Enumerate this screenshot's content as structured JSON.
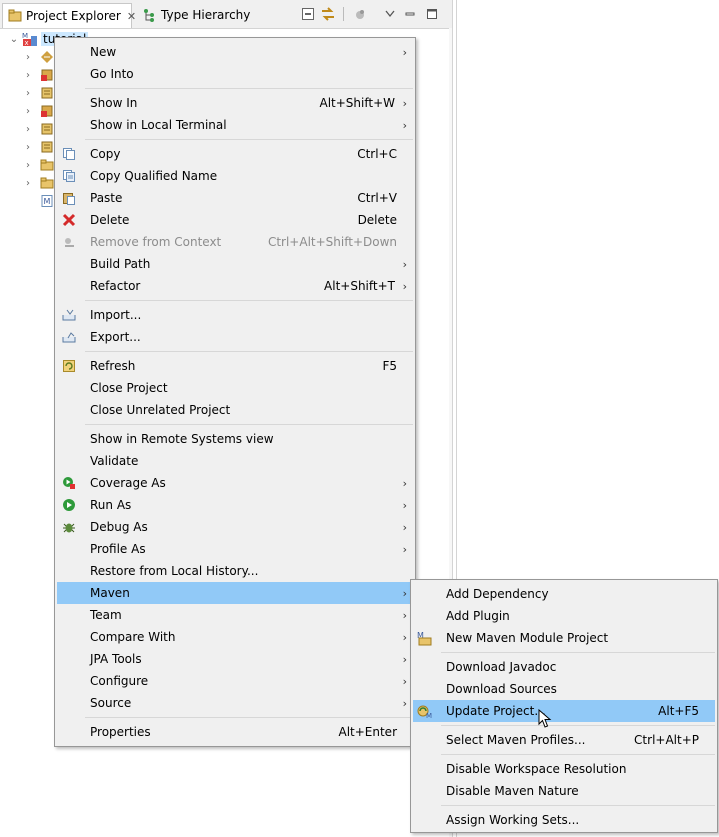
{
  "tabs": [
    {
      "label": "Project Explorer",
      "icon": "project-explorer-icon",
      "closable": true
    },
    {
      "label": "Type Hierarchy",
      "icon": "type-hierarchy-icon",
      "closable": false
    }
  ],
  "tree": {
    "root_label": "tutorial",
    "children_icons": [
      "source-package-icon",
      "jar-icon",
      "library-icon",
      "jar-icon",
      "library-icon",
      "library-icon",
      "folder-icon",
      "folder-icon",
      "pom-file-icon"
    ]
  },
  "main_menu": {
    "items": [
      {
        "label": "New",
        "shortcut": "",
        "submenu": true
      },
      {
        "label": "Go Into",
        "shortcut": ""
      },
      {
        "separator": true
      },
      {
        "label": "Show In",
        "shortcut": "Alt+Shift+W",
        "submenu": true
      },
      {
        "label": "Show in Local Terminal",
        "shortcut": "",
        "submenu": true
      },
      {
        "separator": true
      },
      {
        "label": "Copy",
        "shortcut": "Ctrl+C",
        "icon": "copy-icon"
      },
      {
        "label": "Copy Qualified Name",
        "shortcut": "",
        "icon": "copy-qualified-icon"
      },
      {
        "label": "Paste",
        "shortcut": "Ctrl+V",
        "icon": "paste-icon"
      },
      {
        "label": "Delete",
        "shortcut": "Delete",
        "icon": "delete-icon"
      },
      {
        "label": "Remove from Context",
        "shortcut": "Ctrl+Alt+Shift+Down",
        "icon": "remove-context-icon",
        "disabled": true
      },
      {
        "label": "Build Path",
        "shortcut": "",
        "submenu": true
      },
      {
        "label": "Refactor",
        "shortcut": "Alt+Shift+T",
        "submenu": true
      },
      {
        "separator": true
      },
      {
        "label": "Import...",
        "shortcut": "",
        "icon": "import-icon"
      },
      {
        "label": "Export...",
        "shortcut": "",
        "icon": "export-icon"
      },
      {
        "separator": true
      },
      {
        "label": "Refresh",
        "shortcut": "F5",
        "icon": "refresh-icon"
      },
      {
        "label": "Close Project",
        "shortcut": ""
      },
      {
        "label": "Close Unrelated Project",
        "shortcut": ""
      },
      {
        "separator": true
      },
      {
        "label": "Show in Remote Systems view",
        "shortcut": ""
      },
      {
        "label": "Validate",
        "shortcut": ""
      },
      {
        "label": "Coverage As",
        "shortcut": "",
        "submenu": true,
        "icon": "coverage-icon"
      },
      {
        "label": "Run As",
        "shortcut": "",
        "submenu": true,
        "icon": "run-icon"
      },
      {
        "label": "Debug As",
        "shortcut": "",
        "submenu": true,
        "icon": "debug-icon"
      },
      {
        "label": "Profile As",
        "shortcut": "",
        "submenu": true
      },
      {
        "label": "Restore from Local History...",
        "shortcut": ""
      },
      {
        "label": "Maven",
        "shortcut": "",
        "submenu": true,
        "highlighted": true
      },
      {
        "label": "Team",
        "shortcut": "",
        "submenu": true
      },
      {
        "label": "Compare With",
        "shortcut": "",
        "submenu": true
      },
      {
        "label": "JPA Tools",
        "shortcut": "",
        "submenu": true
      },
      {
        "label": "Configure",
        "shortcut": "",
        "submenu": true
      },
      {
        "label": "Source",
        "shortcut": "",
        "submenu": true
      },
      {
        "separator": true
      },
      {
        "label": "Properties",
        "shortcut": "Alt+Enter"
      }
    ]
  },
  "maven_menu": {
    "items": [
      {
        "label": "Add Dependency",
        "shortcut": ""
      },
      {
        "label": "Add Plugin",
        "shortcut": ""
      },
      {
        "label": "New Maven Module Project",
        "shortcut": "",
        "icon": "maven-module-icon"
      },
      {
        "separator": true
      },
      {
        "label": "Download Javadoc",
        "shortcut": ""
      },
      {
        "label": "Download Sources",
        "shortcut": ""
      },
      {
        "label": "Update Project...",
        "shortcut": "Alt+F5",
        "icon": "maven-update-icon",
        "highlighted": true
      },
      {
        "separator": true
      },
      {
        "label": "Select Maven Profiles...",
        "shortcut": "Ctrl+Alt+P"
      },
      {
        "separator": true
      },
      {
        "label": "Disable Workspace Resolution",
        "shortcut": ""
      },
      {
        "label": "Disable Maven Nature",
        "shortcut": ""
      },
      {
        "separator": true
      },
      {
        "label": "Assign Working Sets...",
        "shortcut": ""
      }
    ]
  },
  "arrow_glyph": "›",
  "colors": {
    "highlight": "#91c9f7",
    "menu_bg": "#f0f0f0"
  }
}
